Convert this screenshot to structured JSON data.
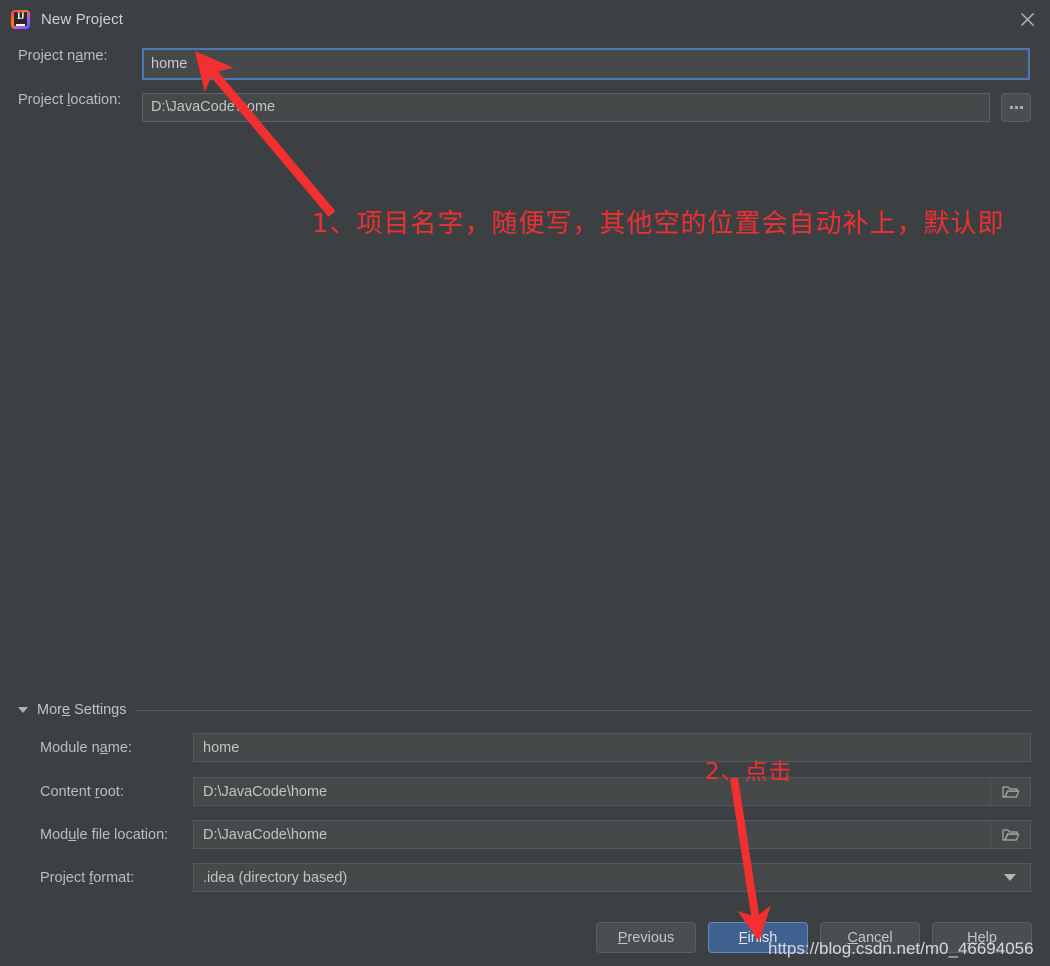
{
  "window": {
    "title": "New Project",
    "icon": "intellij-idea-logo",
    "close_icon": "close-icon"
  },
  "form": {
    "project_name": {
      "label_before": "Project n",
      "label_mnemonic": "a",
      "label_after": "me:",
      "value": "home"
    },
    "project_location": {
      "label_before": "Project ",
      "label_mnemonic": "l",
      "label_after": "ocation:",
      "value": "D:\\JavaCode\\home"
    },
    "browse_button_label": "...",
    "browse_icon": "ellipsis-icon"
  },
  "more_settings": {
    "title_before": "Mor",
    "title_mnemonic": "e",
    "title_after": " Settings",
    "expanded": true,
    "collapse_icon": "triangle-down-icon",
    "rows": [
      {
        "label_before": "Module n",
        "label_mnemonic": "a",
        "label_after": "me:",
        "value": "home",
        "trailing_icon": ""
      },
      {
        "label_before": "Content ",
        "label_mnemonic": "r",
        "label_after": "oot:",
        "value": "D:\\JavaCode\\home",
        "trailing_icon": "folder-icon"
      },
      {
        "label_before": "Mod",
        "label_mnemonic": "u",
        "label_after": "le file location:",
        "value": "D:\\JavaCode\\home",
        "trailing_icon": "folder-icon"
      },
      {
        "label_before": "Project ",
        "label_mnemonic": "f",
        "label_after": "ormat:",
        "value": ".idea (directory based)",
        "trailing_icon": "chevron-down-icon"
      }
    ]
  },
  "buttons": {
    "previous": {
      "before": "",
      "mnemonic": "P",
      "after": "revious"
    },
    "finish": {
      "before": "",
      "mnemonic": "F",
      "after": "inish"
    },
    "cancel": {
      "before": "",
      "mnemonic": "C",
      "after": "ancel"
    },
    "help": {
      "before": "",
      "mnemonic": "H",
      "after": "elp"
    }
  },
  "annotations": {
    "step1": "1、项目名字，随便写，其他空的位置会自动补上，默认即",
    "step2": "2、点击",
    "arrow_color": "#f03030"
  },
  "watermark": "https://blog.csdn.net/m0_46694056",
  "colors": {
    "background": "#3c4043",
    "field_background": "#45494a",
    "field_border": "#55595c",
    "focus_border": "#4b78b5",
    "primary_button": "#3f618f",
    "text": "#bcbdbe",
    "annotation_red": "#f03030"
  }
}
